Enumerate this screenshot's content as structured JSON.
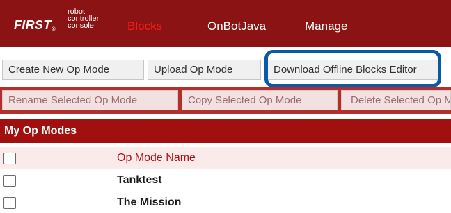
{
  "brand": {
    "logo_text": "FIRST",
    "logo_mark": "®",
    "subtitle_lines": [
      "robot",
      "controller",
      "console"
    ]
  },
  "nav": {
    "items": [
      {
        "label": "Blocks",
        "active": true
      },
      {
        "label": "OnBotJava",
        "active": false
      },
      {
        "label": "Manage",
        "active": false
      }
    ]
  },
  "toolbar": {
    "row1": [
      {
        "label": "Create New Op Mode"
      },
      {
        "label": "Upload Op Mode"
      },
      {
        "label": "Download Offline Blocks Editor"
      }
    ],
    "row2": [
      {
        "label": "Rename Selected Op Mode",
        "disabled": true
      },
      {
        "label": "Copy Selected Op Mode",
        "disabled": true
      },
      {
        "label": "Delete Selected Op Mode",
        "disabled": true
      }
    ]
  },
  "section": {
    "title": "My Op Modes"
  },
  "table": {
    "header": {
      "column": "Op Mode Name"
    },
    "rows": [
      {
        "name": "Tanktest"
      },
      {
        "name": "The Mission"
      }
    ]
  },
  "colors": {
    "nav_bg": "#8b1313",
    "active_nav": "#ff1a1a",
    "section_bg": "#a10f0f",
    "highlight": "#0b5aa8"
  }
}
